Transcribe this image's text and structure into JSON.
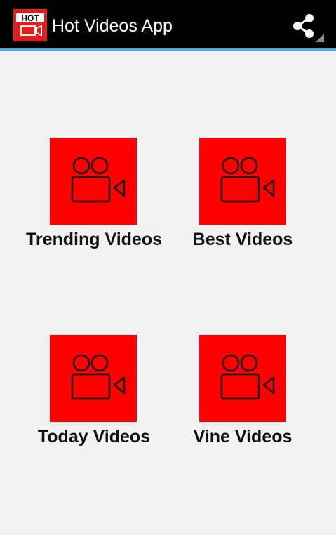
{
  "app_bar": {
    "title": "Hot Videos App",
    "logo_text": "HOT",
    "icon": "app-logo-icon",
    "share_icon": "share-icon",
    "background_color": "#000000",
    "divider_color": "#33b5e5"
  },
  "tiles": [
    {
      "label": "Trending Videos",
      "icon": "video-camera-icon"
    },
    {
      "label": "Best Videos",
      "icon": "video-camera-icon"
    },
    {
      "label": "Today Videos",
      "icon": "video-camera-icon"
    },
    {
      "label": "Vine Videos",
      "icon": "video-camera-icon"
    }
  ],
  "colors": {
    "tile_background": "#ff0000",
    "page_background": "#f2f2f2",
    "label_text": "#111111"
  }
}
